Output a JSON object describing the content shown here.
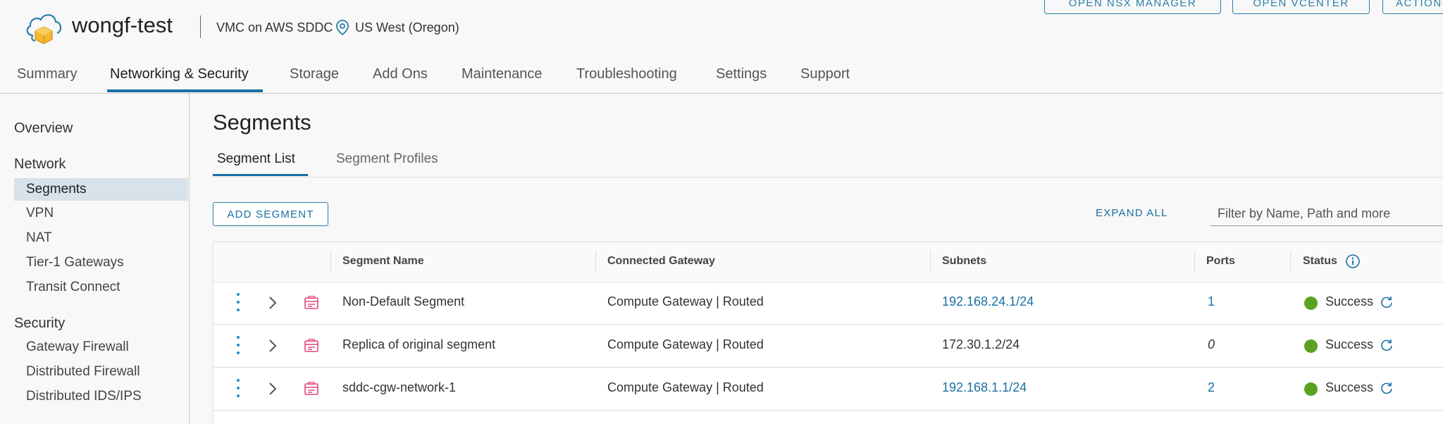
{
  "header": {
    "app_title": "wongf-test",
    "sddc_type": "VMC on AWS SDDC",
    "region": "US West (Oregon)",
    "buttons": [
      "OPEN NSX MANAGER",
      "OPEN VCENTER",
      "ACTIONS"
    ]
  },
  "main_tabs": [
    {
      "label": "Summary"
    },
    {
      "label": "Networking & Security"
    },
    {
      "label": "Storage"
    },
    {
      "label": "Add Ons"
    },
    {
      "label": "Maintenance"
    },
    {
      "label": "Troubleshooting"
    },
    {
      "label": "Settings"
    },
    {
      "label": "Support"
    }
  ],
  "sidebar": {
    "overview": "Overview",
    "network_heading": "Network",
    "network_items": [
      "Segments",
      "VPN",
      "NAT",
      "Tier-1 Gateways",
      "Transit Connect"
    ],
    "security_heading": "Security",
    "security_items": [
      "Gateway Firewall",
      "Distributed Firewall",
      "Distributed IDS/IPS"
    ]
  },
  "page": {
    "title": "Segments",
    "sub_tabs": [
      "Segment List",
      "Segment Profiles"
    ],
    "add_button": "ADD SEGMENT",
    "expand_all": "EXPAND ALL",
    "filter_placeholder": "Filter by Name, Path and more"
  },
  "table": {
    "columns": [
      "Segment Name",
      "Connected Gateway",
      "Subnets",
      "Ports",
      "Status"
    ],
    "rows": [
      {
        "name": "Non-Default Segment",
        "gateway": "Compute Gateway | Routed",
        "subnet": "192.168.24.1/24",
        "ports": "1",
        "status": "Success"
      },
      {
        "name": "Replica of original segment",
        "gateway": "Compute Gateway | Routed",
        "subnet": "172.30.1.2/24",
        "ports": "0",
        "status": "Success"
      },
      {
        "name": "sddc-cgw-network-1",
        "gateway": "Compute Gateway | Routed",
        "subnet": "192.168.1.1/24",
        "ports": "2",
        "status": "Success"
      }
    ]
  },
  "colors": {
    "accent": "#1a6fa3",
    "success": "#5aa220",
    "segment_icon": "#e0457b"
  }
}
